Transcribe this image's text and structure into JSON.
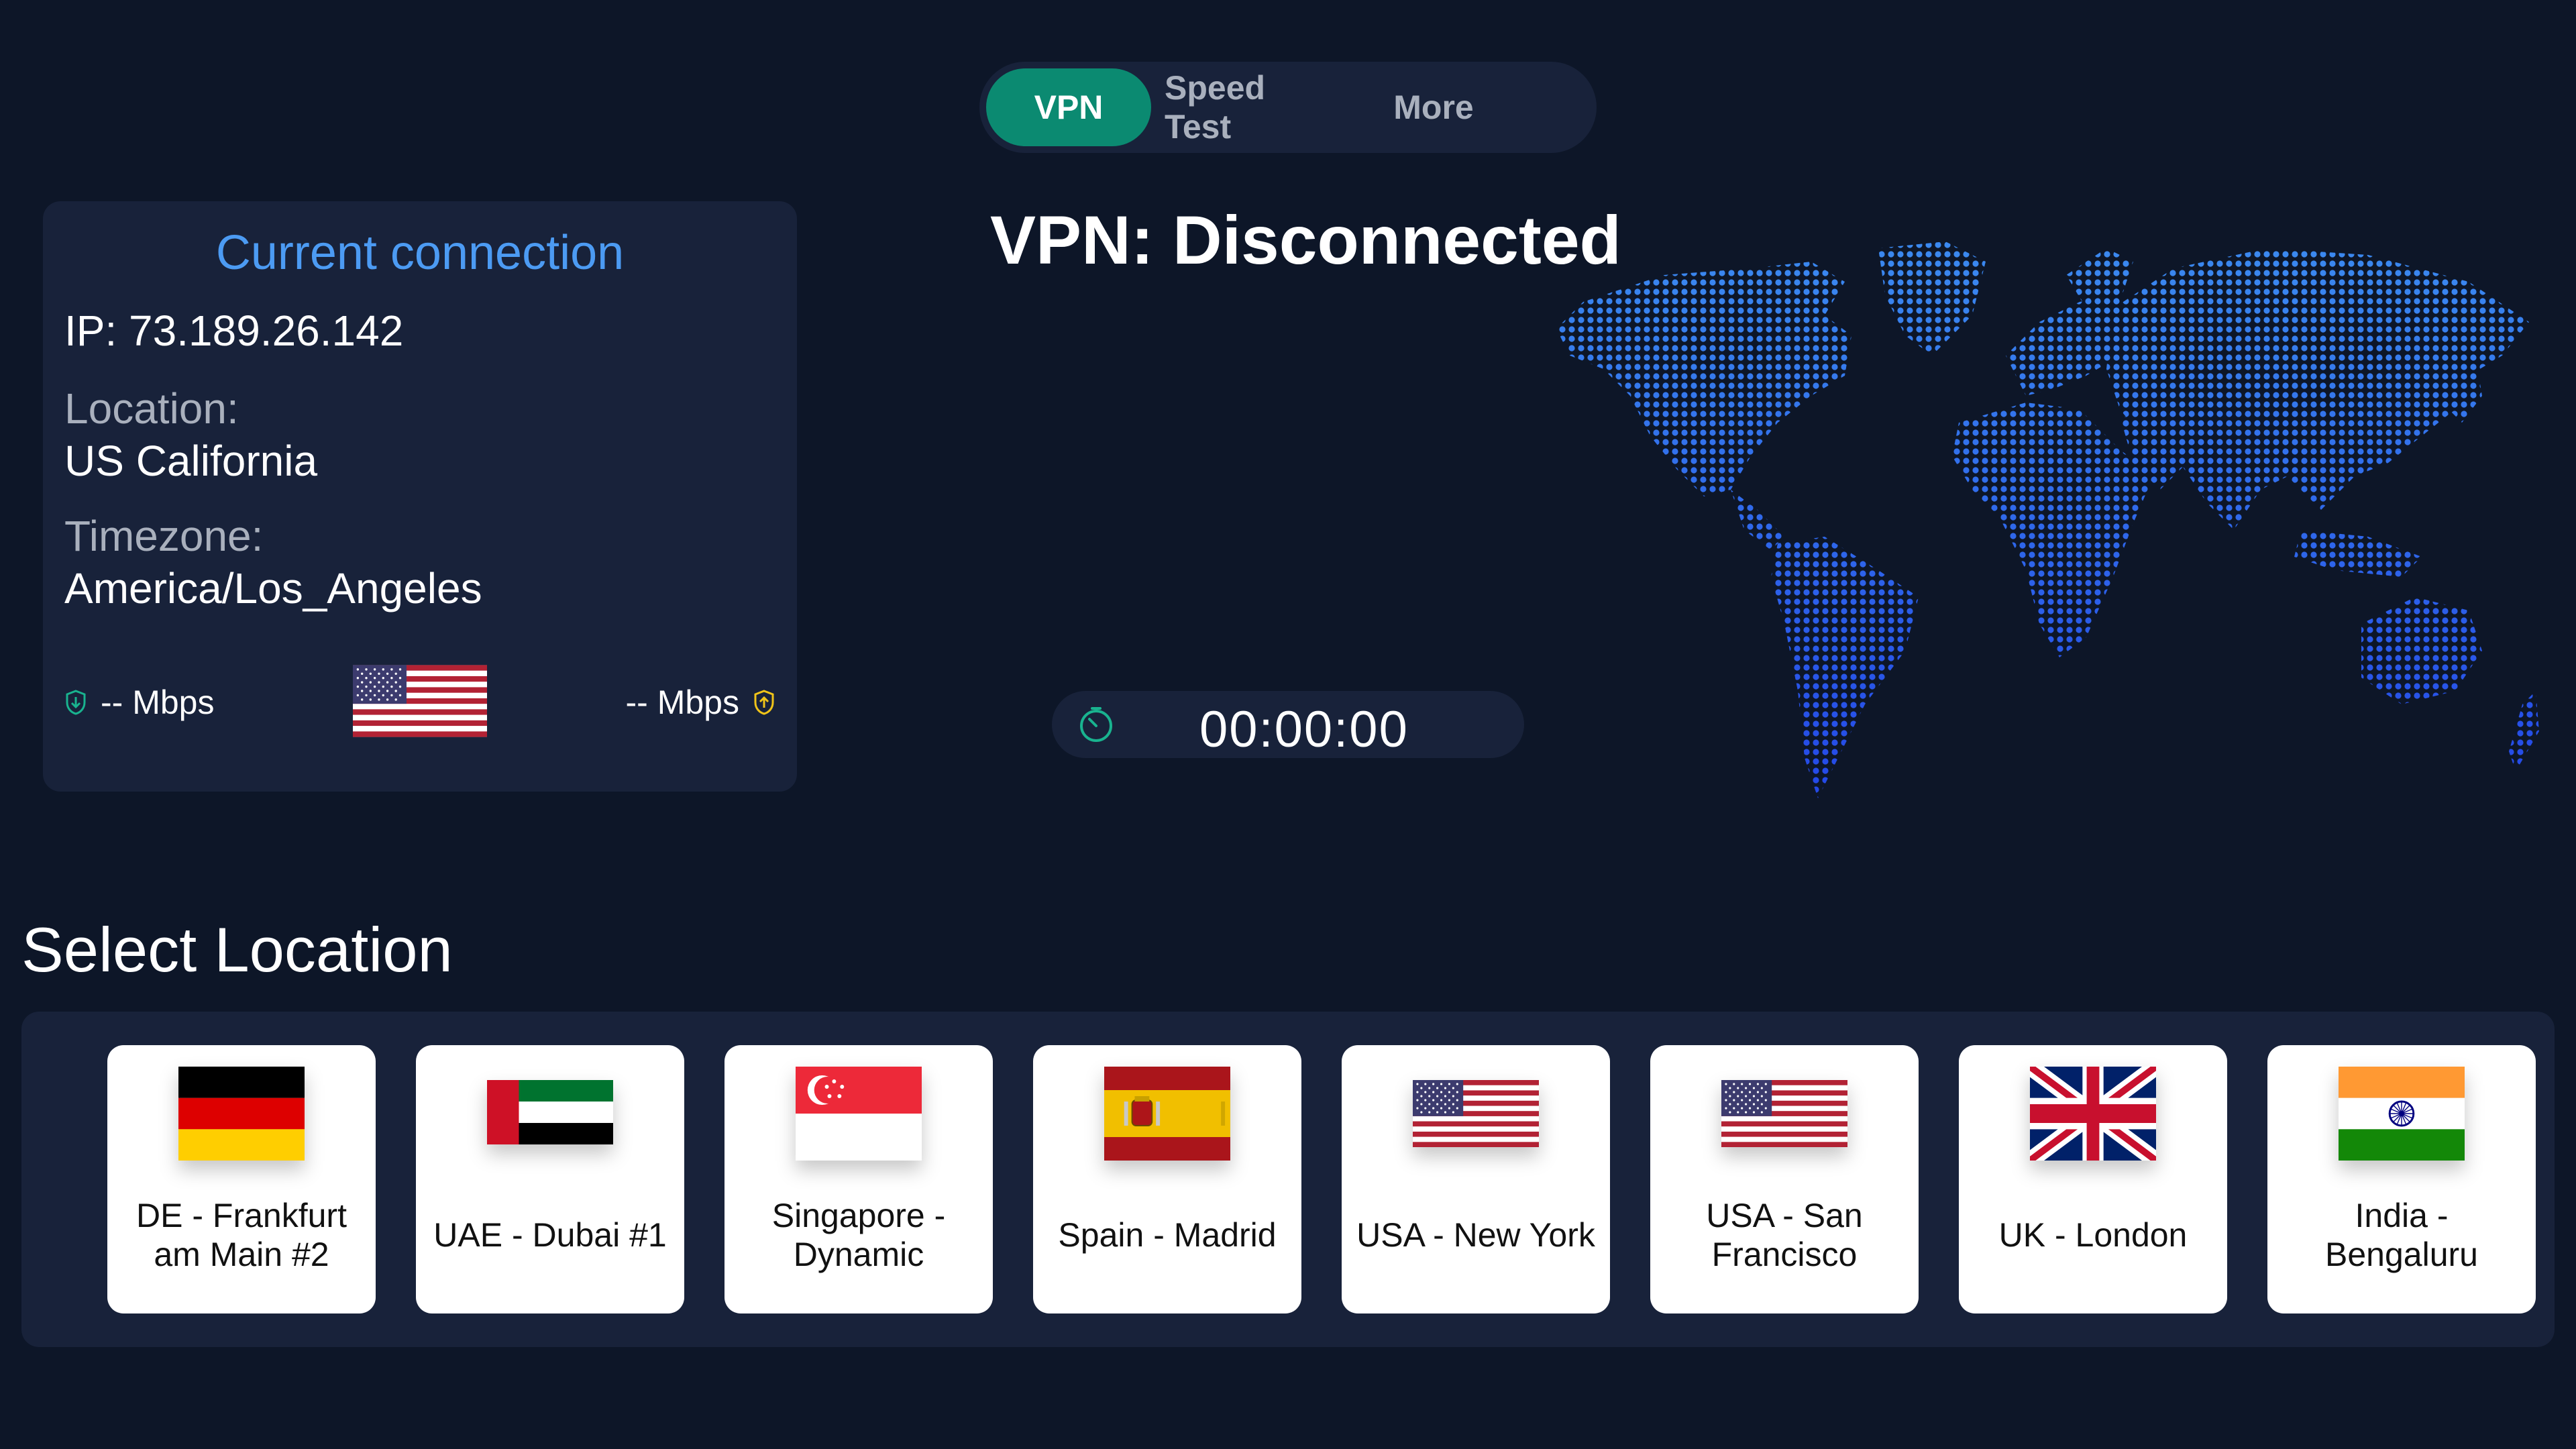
{
  "tabs": {
    "vpn": "VPN",
    "speed_test": "Speed Test",
    "more": "More"
  },
  "connection": {
    "title": "Current connection",
    "ip": "IP: 73.189.26.142",
    "location_label": "Location:",
    "location_value": "US California",
    "timezone_label": "Timezone:",
    "timezone_value": "America/Los_Angeles",
    "download_speed": "-- Mbps",
    "upload_speed": "-- Mbps",
    "flag": "flag-usa"
  },
  "status": {
    "text": "VPN: Disconnected",
    "timer": "00:00:00"
  },
  "locations": {
    "title": "Select Location",
    "items": [
      {
        "label": "DE - Frankfurt am Main #2",
        "flag": "flag-germany"
      },
      {
        "label": "UAE - Dubai #1",
        "flag": "flag-uae"
      },
      {
        "label": "Singapore - Dynamic",
        "flag": "flag-singapore"
      },
      {
        "label": "Spain - Madrid",
        "flag": "flag-spain"
      },
      {
        "label": "USA - New York",
        "flag": "flag-usa"
      },
      {
        "label": "USA - San Francisco",
        "flag": "flag-usa"
      },
      {
        "label": "UK - London",
        "flag": "flag-uk"
      },
      {
        "label": "India - Bengaluru",
        "flag": "flag-india"
      }
    ]
  },
  "colors": {
    "background": "#0d1628",
    "panel": "#18223a",
    "accent_green": "#0b8a71",
    "accent_blue": "#4c9bf3",
    "map_dots": "#2f6fe0"
  }
}
